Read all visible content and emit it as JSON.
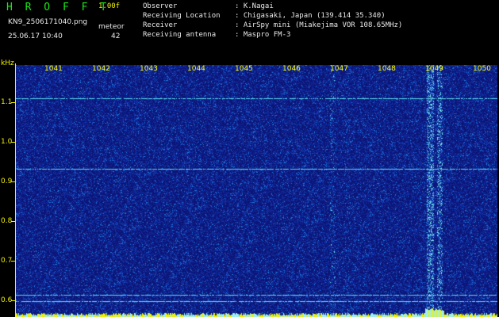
{
  "header": {
    "brand": "H R O F F T",
    "version": "1.00f",
    "filename": "KN9_2506171040.png",
    "datetime": "25.06.17 10:40",
    "meteor_label": "meteor",
    "meteor_count": "42"
  },
  "info": [
    {
      "label": "Observer",
      "value": ": K.Nagai"
    },
    {
      "label": "Receiving Location",
      "value": ": Chigasaki, Japan (139.414 35.340)"
    },
    {
      "label": "Receiver",
      "value": ": AirSpy mini (Miakejima VOR 108.65MHz)"
    },
    {
      "label": "Receiving antenna",
      "value": ": Maspro FM-3"
    }
  ],
  "axis": {
    "unit": "kHz",
    "freq_ticks": [
      "1041",
      "1042",
      "1043",
      "1044",
      "1045",
      "1046",
      "1047",
      "1048",
      "1049",
      "1050"
    ],
    "y_ticks": [
      "1.1",
      "1.0",
      "0.9",
      "0.8",
      "0.7",
      "0.6"
    ]
  },
  "colors": {
    "background": "#000000",
    "spectrum_base": "#1020a0",
    "signal": "#6fe9f2",
    "axis": "#f2f200",
    "brand": "#19e619"
  }
}
